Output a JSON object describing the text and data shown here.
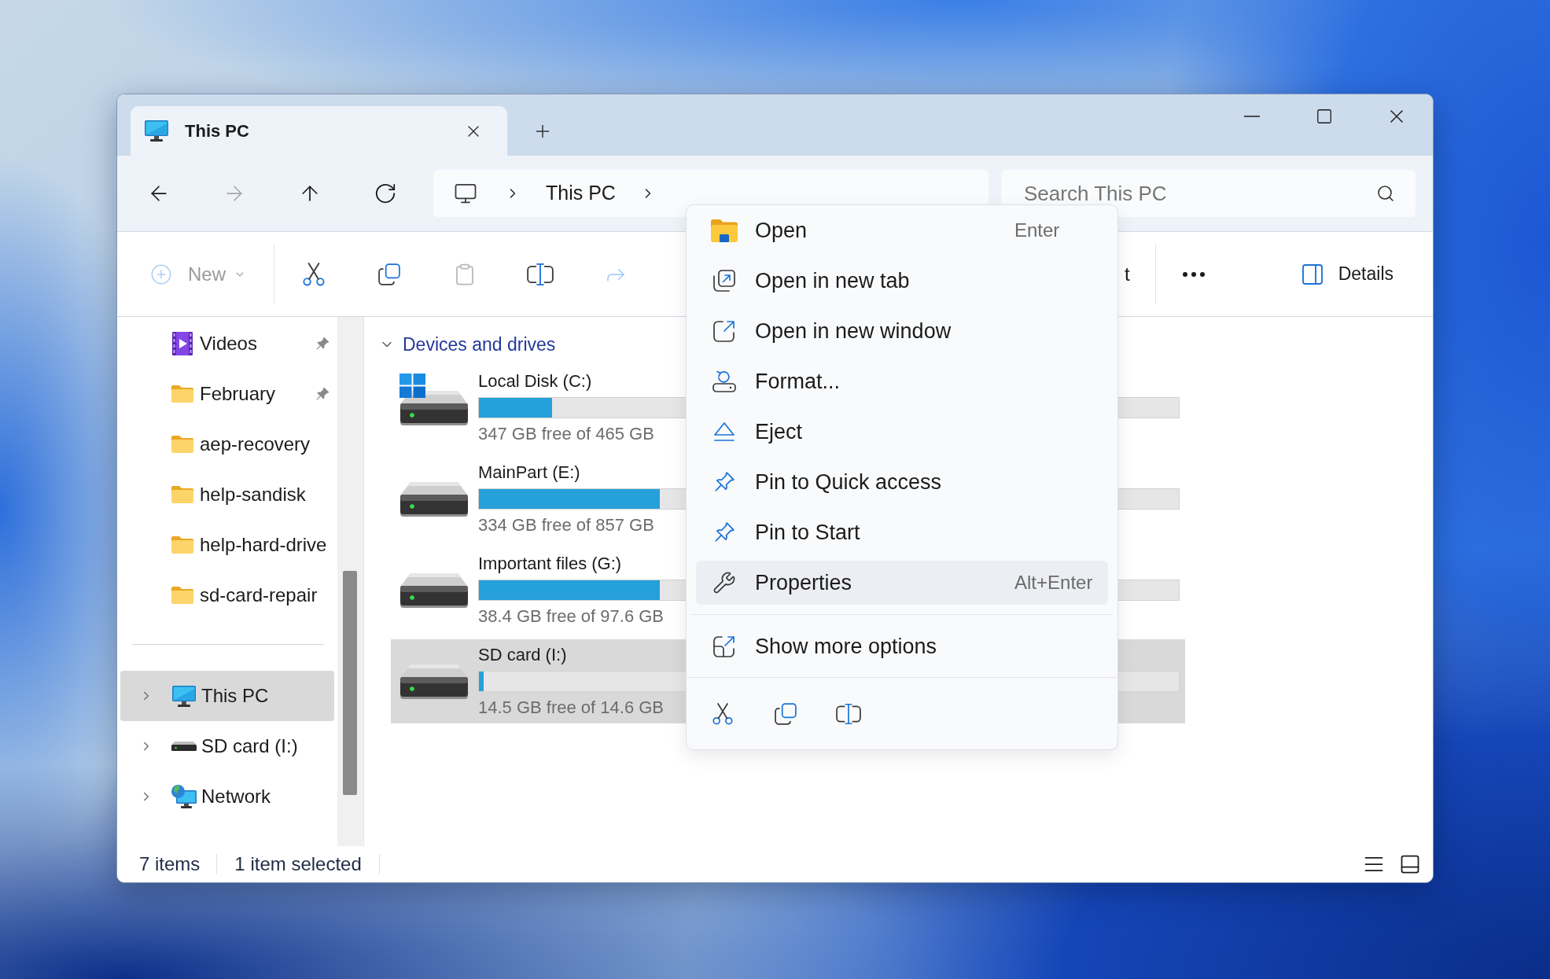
{
  "tabs": [
    {
      "label": "This PC",
      "selected": true
    }
  ],
  "nav_buttons": [
    {
      "kind": "back",
      "disabled": false
    },
    {
      "kind": "forward",
      "disabled": true
    },
    {
      "kind": "up",
      "disabled": false
    },
    {
      "kind": "refresh",
      "disabled": false
    }
  ],
  "address_bar": {
    "path": [
      "This PC"
    ]
  },
  "search": {
    "placeholder": "Search This PC"
  },
  "toolbar": {
    "items": [
      {
        "kind": "new",
        "label": "New",
        "disabled": true
      },
      {
        "kind": "cut",
        "disabled": false
      },
      {
        "kind": "copy",
        "disabled": false
      },
      {
        "kind": "paste",
        "disabled": true
      },
      {
        "kind": "rename",
        "disabled": false
      },
      {
        "kind": "share",
        "disabled": true
      }
    ],
    "covered_button": {
      "label": "t"
    },
    "details_button": {
      "label": "Details"
    }
  },
  "sidebar": {
    "quick_access": [
      {
        "label": "Videos",
        "kind": "videos",
        "pinned": true
      },
      {
        "label": "February",
        "kind": "folder",
        "pinned": true
      },
      {
        "label": "aep-recovery",
        "kind": "folder",
        "pinned": false
      },
      {
        "label": "help-sandisk",
        "kind": "folder",
        "pinned": false
      },
      {
        "label": "help-hard-drive",
        "kind": "folder",
        "pinned": false
      },
      {
        "label": "sd-card-repair",
        "kind": "folder",
        "pinned": false
      }
    ],
    "locations": [
      {
        "label": "This PC",
        "kind": "pc",
        "selected": true,
        "expanded": false
      },
      {
        "label": "SD card (I:)",
        "kind": "drive",
        "selected": false,
        "expanded": false
      },
      {
        "label": "Network",
        "kind": "network",
        "selected": false,
        "expanded": false
      }
    ]
  },
  "content": {
    "group": {
      "title": "Devices and drives",
      "expanded": true
    },
    "drives": [
      {
        "name": "Local Disk (C:)",
        "kind": "system",
        "level": 0.105,
        "free": "347 GB free of 465 GB",
        "selected": false
      },
      {
        "name": "MainPart (E:)",
        "kind": "drive",
        "level": 0.258,
        "free": "334 GB free of 857 GB",
        "selected": false
      },
      {
        "name": "Important files (G:)",
        "kind": "drive",
        "level": 0.258,
        "free": "38.4 GB free of 97.6 GB",
        "selected": false
      },
      {
        "name": "SD card (I:)",
        "kind": "drive",
        "level": 0.007,
        "free": "14.5 GB free of 14.6 GB",
        "selected": true
      }
    ]
  },
  "context_menu": {
    "items": [
      {
        "kind": "open",
        "label": "Open",
        "shortcut": "Enter",
        "selected": false
      },
      {
        "kind": "open_new_tab",
        "label": "Open in new tab",
        "selected": false
      },
      {
        "kind": "open_new_window",
        "label": "Open in new window",
        "selected": false
      },
      {
        "kind": "format",
        "label": "Format...",
        "selected": false
      },
      {
        "kind": "eject",
        "label": "Eject",
        "selected": false
      },
      {
        "kind": "pin_quick_access",
        "label": "Pin to Quick access",
        "selected": false
      },
      {
        "kind": "pin_start",
        "label": "Pin to Start",
        "selected": false
      },
      {
        "kind": "properties",
        "label": "Properties",
        "shortcut": "Alt+Enter",
        "selected": true
      }
    ],
    "extra_items": [
      {
        "kind": "more_options",
        "label": "Show more options",
        "selected": false
      }
    ],
    "actions": [
      {
        "kind": "cut"
      },
      {
        "kind": "copy"
      },
      {
        "kind": "rename"
      }
    ]
  },
  "status_bar": {
    "item_count": "7 items",
    "selection": "1 item selected",
    "views": [
      {
        "kind": "details"
      },
      {
        "kind": "tiles"
      }
    ]
  }
}
